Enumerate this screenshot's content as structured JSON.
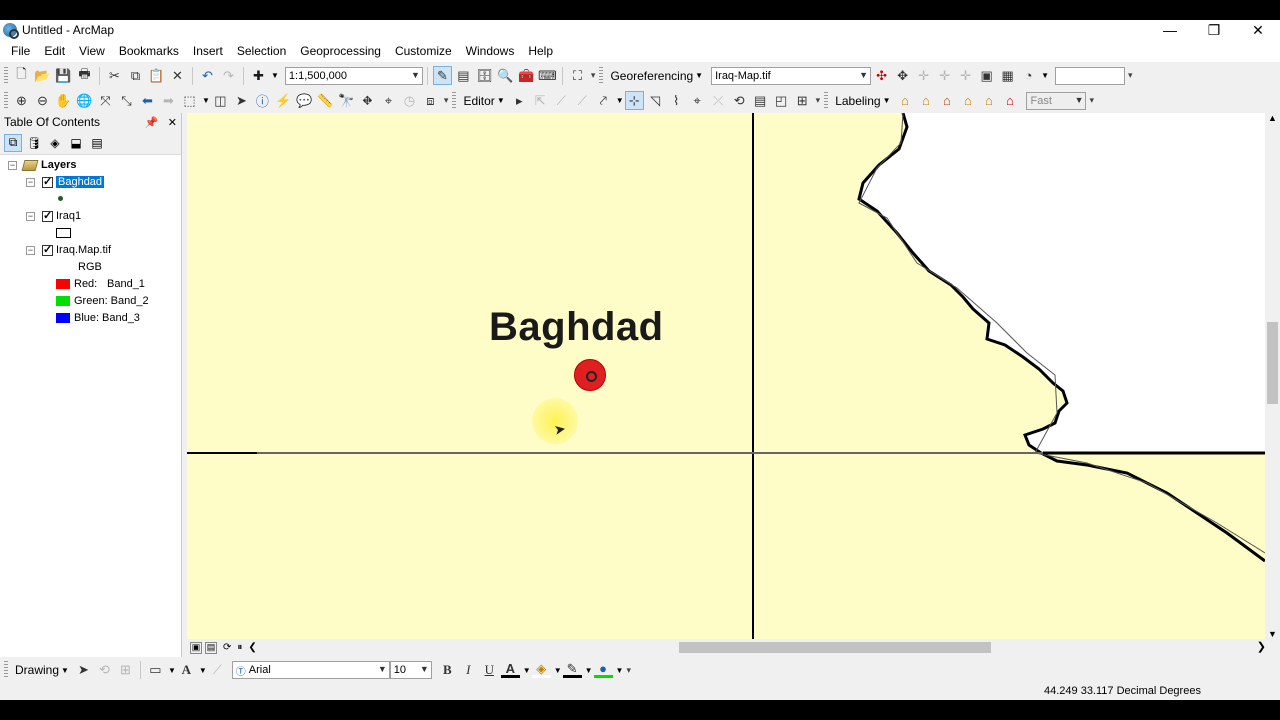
{
  "window": {
    "title": "Untitled - ArcMap",
    "controls": [
      "—",
      "❐",
      "✕"
    ]
  },
  "menu": [
    "File",
    "Edit",
    "View",
    "Bookmarks",
    "Insert",
    "Selection",
    "Geoprocessing",
    "Customize",
    "Windows",
    "Help"
  ],
  "toolbar": {
    "scale_value": "1:1,500,000",
    "georeferencing_label": "Georeferencing",
    "georef_layer": "Iraq-Map.tif",
    "editor_label": "Editor",
    "labeling_label": "Labeling",
    "label_quality": "Fast"
  },
  "toc": {
    "title": "Table Of Contents",
    "layers_group": "Layers",
    "layers": [
      {
        "name": "Baghdad",
        "checked": true,
        "selected": true
      },
      {
        "name": "Iraq1",
        "checked": true,
        "selected": false
      },
      {
        "name": "Iraq.Map.tif",
        "checked": true,
        "selected": false
      }
    ],
    "rgb_label": "RGB",
    "bands": [
      {
        "channel": "Red:",
        "band": "Band_1",
        "color": "#ff0000"
      },
      {
        "channel": "Green:",
        "band": "Band_2",
        "color": "#00e000"
      },
      {
        "channel": "Blue:",
        "band": "Band_3",
        "color": "#0000ff"
      }
    ]
  },
  "map": {
    "city_label": "Baghdad",
    "background_color": "#fefdc8",
    "point_color": "#e02020"
  },
  "drawing": {
    "label": "Drawing",
    "font": "Arial",
    "font_size": "10",
    "bold": "B",
    "italic": "I",
    "underline": "U",
    "font_color_glyph": "A"
  },
  "status": {
    "coordinates": "44.249  33.117 Decimal Degrees"
  }
}
